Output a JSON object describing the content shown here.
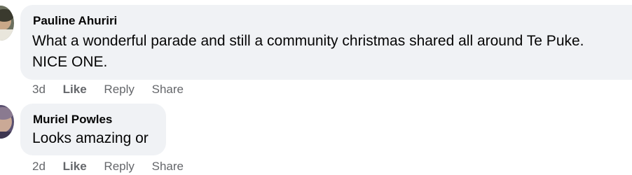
{
  "comments": [
    {
      "author": "Pauline Ahuriri",
      "text_line1": "What a wonderful parade and still a community christmas shared all around Te Puke.",
      "text_line2": "NICE ONE.",
      "time": "3d",
      "like_label": "Like",
      "reply_label": "Reply",
      "share_label": "Share",
      "avatar_icon": "profile-photo"
    },
    {
      "author": "Muriel Powles",
      "text_line1": "Looks amazing or",
      "time": "2d",
      "like_label": "Like",
      "reply_label": "Reply",
      "share_label": "Share",
      "avatar_icon": "profile-photo"
    }
  ],
  "colors": {
    "bubble": "#f0f2f5",
    "text": "#050505",
    "meta": "#65676b"
  }
}
